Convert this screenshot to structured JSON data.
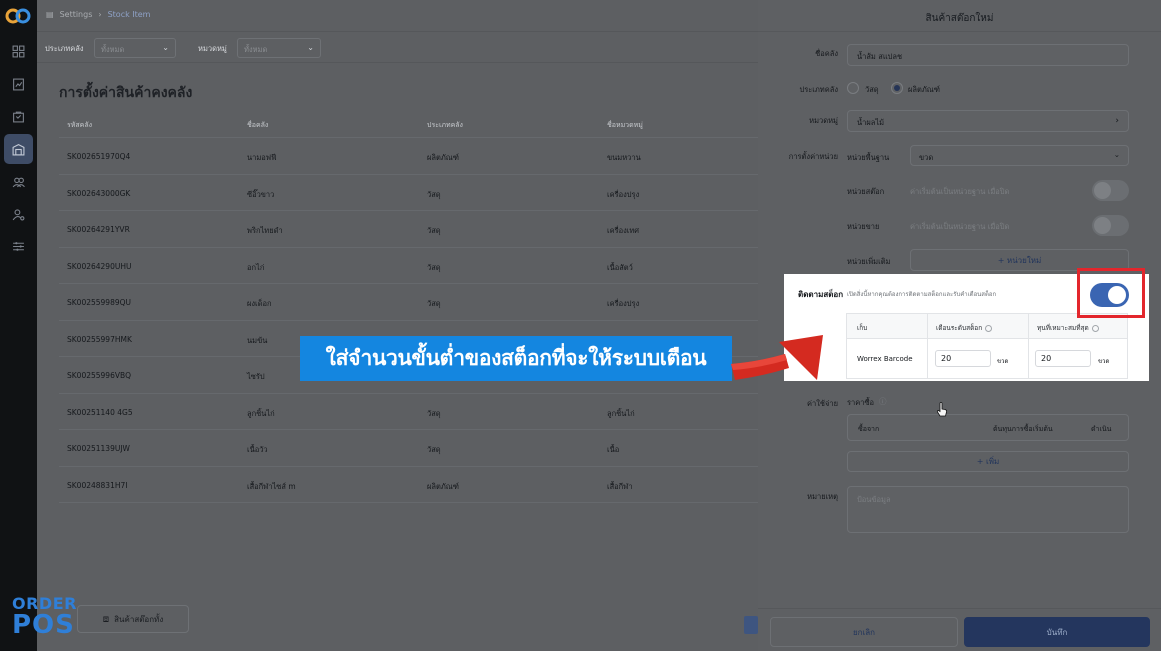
{
  "breadcrumb": {
    "root": "Settings",
    "current": "Stock Item"
  },
  "filters": {
    "type_label": "ประเภทคลัง",
    "type_value": "ทั้งหมด",
    "category_label": "หมวดหมู่",
    "category_value": "ทั้งหมด"
  },
  "page_title": "การตั้งค่าสินค้าคงคลัง",
  "table": {
    "columns": [
      "รหัสคลัง",
      "ชื่อคลัง",
      "ประเภทคลัง",
      "ชื่อหมวดหมู่"
    ],
    "rows": [
      [
        "SK002651970Q4",
        "นามอฟฟี",
        "ผลิตภัณฑ์",
        "ขนมหวาน"
      ],
      [
        "SK002643000GK",
        "ซีอิ๊วขาว",
        "วัสดุ",
        "เครื่องปรุง"
      ],
      [
        "SK00264291YVR",
        "พริกไทยดำ",
        "วัสดุ",
        "เครื่องเทศ"
      ],
      [
        "SK00264290UHU",
        "อกไก่",
        "วัสดุ",
        "เนื้อสัตว์"
      ],
      [
        "SK002559989QU",
        "ผงเด็อก",
        "วัสดุ",
        "เครื่องปรุง"
      ],
      [
        "SK00255997HMK",
        "นมข้น",
        "",
        ""
      ],
      [
        "SK00255996VBQ",
        "ไซรัป",
        "",
        ""
      ],
      [
        "SK00251140 4G5",
        "ลูกชิ้นไก่",
        "วัสดุ",
        "ลูกชิ้นไก่"
      ],
      [
        "SK00251139UJW",
        "เนื้อวัว",
        "วัสดุ",
        "เนื้อ"
      ],
      [
        "SK00248831H7I",
        "เสื้อกีฬาไซส์ m",
        "ผลิตภัณฑ์",
        "เสื้อกีฬา"
      ]
    ]
  },
  "bottom_button": "สินค้าสต๊อกทั้ง",
  "brand": {
    "line1": "ORDER",
    "line2": "POS"
  },
  "panel": {
    "title": "สินค้าสต๊อกใหม่",
    "name_label": "ชื่อคลัง",
    "name_value": "น้ำส้ม สแปลช",
    "type_label": "ประเภทคลัง",
    "type_option1": "วัสดุ",
    "type_option2": "ผลิตภัณฑ์",
    "category_label": "หมวดหมู่",
    "category_value": "น้ำผลไม้",
    "unit_label": "การตั้งค่าหน่วย",
    "base_unit_label": "หน่วยพื้นฐาน",
    "base_unit_value": "ขวด",
    "stock_unit_label": "หน่วยสต๊อก",
    "stock_unit_hint": "ค่าเริ่มต้นเป็นหน่วยฐาน เมื่อปิด",
    "sale_unit_label": "หน่วยขาย",
    "sale_unit_hint": "ค่าเริ่มต้นเป็นหน่วยฐาน เมื่อปิด",
    "extra_unit_label": "หน่วยเพิ่มเติม",
    "new_unit_button": "+ หน่วยใหม่",
    "tracking": {
      "label": "ติดตามสต็อก",
      "description": "เปิดสิ่งนี้หากคุณต้องการติดตามสต็อกและรับคำเตือนสต็อก",
      "col_store": "เก็บ",
      "col_alert": "เตือนระดับสต็อก",
      "col_optimal": "ทุนที่เหมาะสมที่สุด",
      "store_name": "Worrex Barcode",
      "alert_value": "20",
      "alert_unit": "ขวด",
      "optimal_value": "20",
      "optimal_unit": "ขวด",
      "enabled": true
    },
    "cost_label": "ค่าใช้จ่าย",
    "purchase_price_label": "ราคาซื้อ",
    "cost_col1": "ซื้อจาก",
    "cost_col2": "ต้นทุนการซื้อเริ่มต้น",
    "cost_col3": "ดำเนิน",
    "add_button": "+ เพิ่ม",
    "note_label": "หมายเหตุ",
    "note_placeholder": "ป้อนข้อมูล",
    "cancel_button": "ยกเลิก",
    "save_button": "บันทึก"
  },
  "overlay": {
    "banner_text": "ใส่จำนวนขั้นต่ำของสต็อกที่จะให้ระบบเตือน",
    "banner_color": "#1486e0",
    "highlight_color": "#e3262c"
  },
  "nav_icons": [
    "dashboard-icon",
    "report-icon",
    "bag-icon",
    "warehouse-icon",
    "users-icon",
    "user-settings-icon",
    "sliders-icon"
  ]
}
